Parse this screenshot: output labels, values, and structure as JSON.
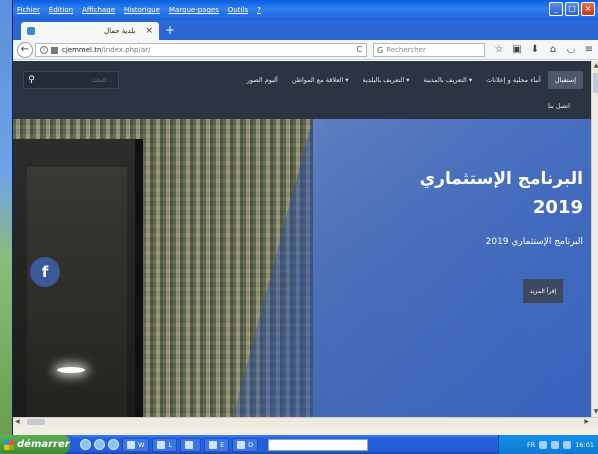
{
  "browser": {
    "menu": [
      "Fichier",
      "Édition",
      "Affichage",
      "Historique",
      "Marque-pages",
      "Outils",
      "?"
    ],
    "window_controls": {
      "minimize": "_",
      "maximize": "□",
      "close": "×"
    },
    "tab": {
      "title": "بلدية جمال",
      "close": "×"
    },
    "new_tab": "+",
    "url": {
      "domain": "cjemmel.tn",
      "path": "/index.php/ar/"
    },
    "search_placeholder": "Rechercher",
    "back": "←",
    "reload": "C"
  },
  "site": {
    "nav": [
      {
        "label": "إستقبال",
        "active": true
      },
      {
        "label": "أنباء محلية و إعلانات",
        "active": false
      },
      {
        "label": "التعريف بالمدينة ▾",
        "active": false
      },
      {
        "label": "التعريف بالبلدية ▾",
        "active": false
      },
      {
        "label": "العلاقة مع المواطن ▾",
        "active": false
      },
      {
        "label": "ألبوم الصور",
        "active": false
      }
    ],
    "nav_row2": "اتصل بنا",
    "search_placeholder": "البحث ..."
  },
  "hero": {
    "title": "البرنامج الإستثماري",
    "year": "2019",
    "subtitle": "البرنامج الإستثماري 2019",
    "read_more": "إقرأ المزيد",
    "facebook": "f"
  },
  "taskbar": {
    "start": "démarrer",
    "tasks": [
      "W",
      "L",
      "",
      "E",
      "D"
    ],
    "center_text": "",
    "tray": {
      "lang": "FR",
      "time": "16:01"
    }
  },
  "colors": {
    "header_bg": "#2b3442",
    "nav_active": "#4d5868",
    "facebook": "#3b5998",
    "taskbar": "#245edb",
    "start": "#3c8a34"
  }
}
